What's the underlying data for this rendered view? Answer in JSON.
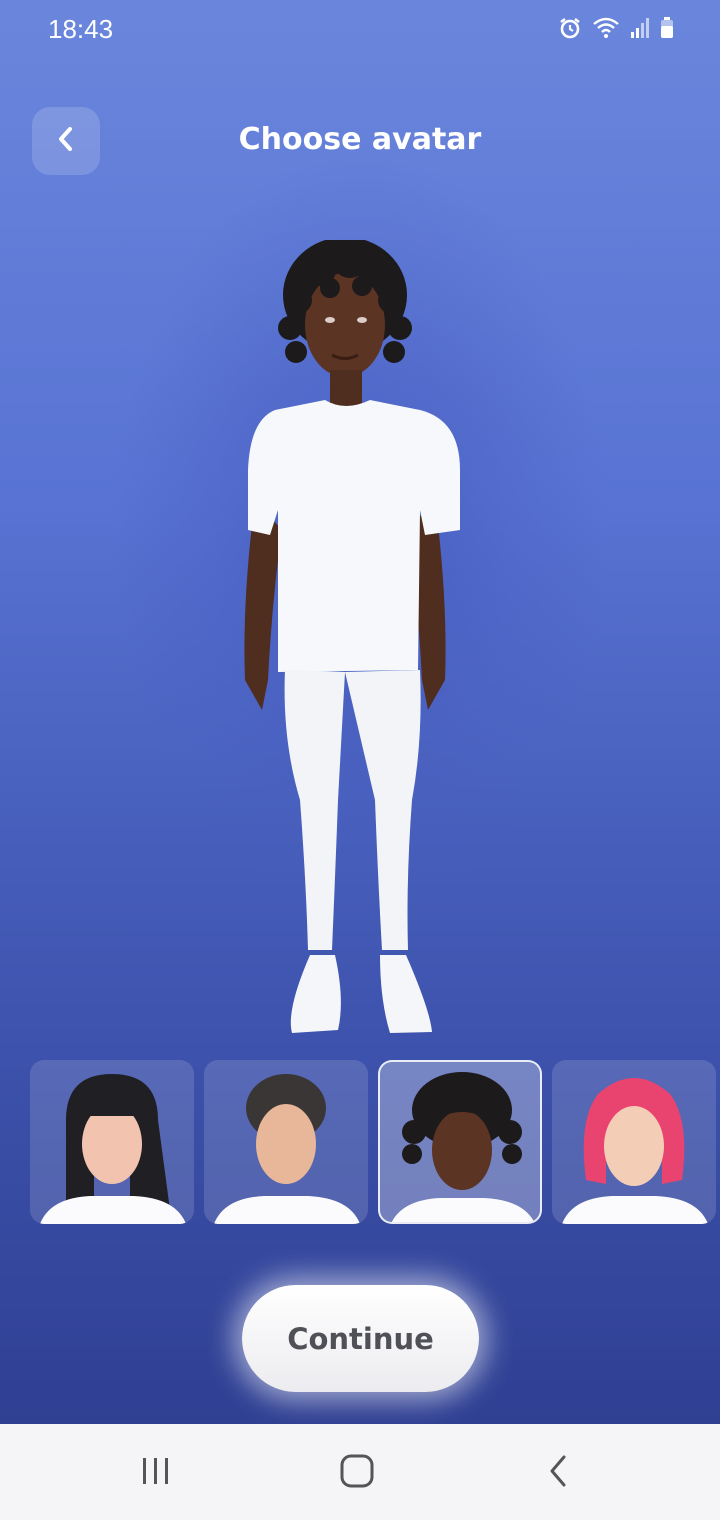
{
  "status_bar": {
    "time": "18:43"
  },
  "header": {
    "title": "Choose avatar"
  },
  "avatar_options": [
    {
      "id": "long-black-hair",
      "hair_color": "#1f1f24",
      "skin_color": "#f2c4b0",
      "selected": false
    },
    {
      "id": "short-dark-hair",
      "hair_color": "#3a3635",
      "skin_color": "#e8b79a",
      "selected": false
    },
    {
      "id": "curly-locs",
      "hair_color": "#1c1a1a",
      "skin_color": "#5b3424",
      "selected": true
    },
    {
      "id": "pink-bob",
      "hair_color": "#e9436f",
      "skin_color": "#f4cdb7",
      "selected": false
    }
  ],
  "actions": {
    "continue_label": "Continue"
  },
  "colors": {
    "accent": "#5873d3",
    "button_text": "#505057"
  }
}
